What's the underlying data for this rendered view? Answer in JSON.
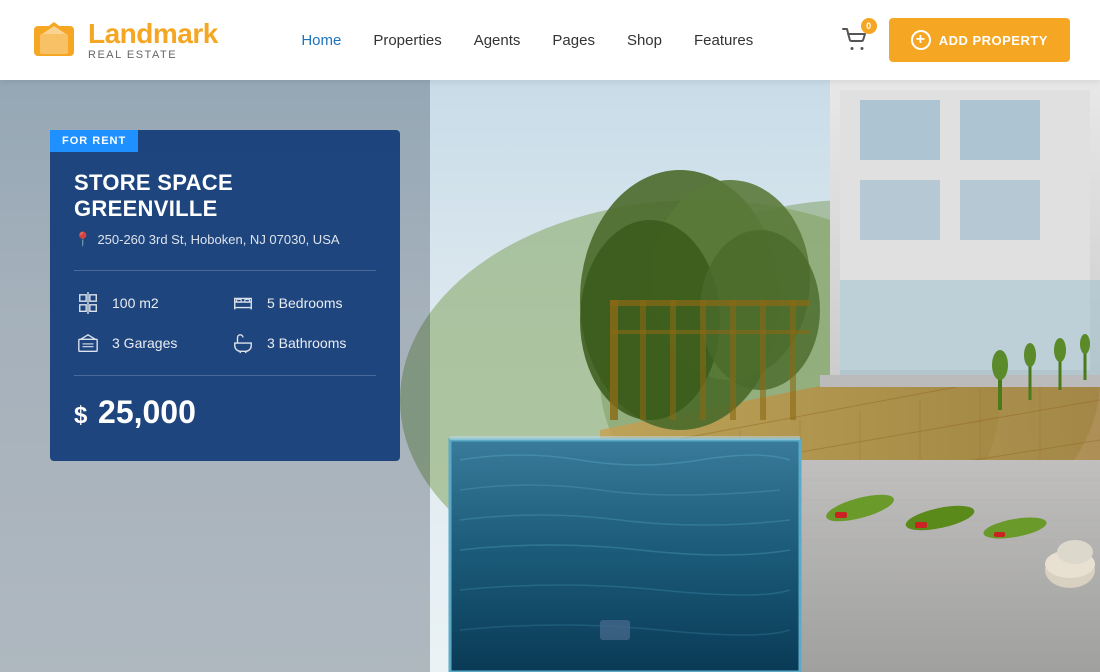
{
  "logo": {
    "name_part1": "Land",
    "name_part2": "mark",
    "subtitle": "Real Estate",
    "icon_alt": "landmark-logo"
  },
  "nav": {
    "items": [
      {
        "label": "Home",
        "active": true
      },
      {
        "label": "Properties",
        "active": false
      },
      {
        "label": "Agents",
        "active": false
      },
      {
        "label": "Pages",
        "active": false
      },
      {
        "label": "Shop",
        "active": false
      },
      {
        "label": "Features",
        "active": false
      }
    ]
  },
  "cart": {
    "badge": "0"
  },
  "add_property_btn": "ADD PROPERTY",
  "property": {
    "status": "FOR RENT",
    "title": "STORE SPACE GREENVILLE",
    "address": "250-260 3rd St, Hoboken, NJ 07030, USA",
    "specs": [
      {
        "icon": "area-icon",
        "label": "100 m2"
      },
      {
        "icon": "bed-icon",
        "label": "5 Bedrooms"
      },
      {
        "icon": "garage-icon",
        "label": "3 Garages"
      },
      {
        "icon": "bath-icon",
        "label": "3 Bathrooms"
      }
    ],
    "price_prefix": "$ ",
    "price": "25,000"
  }
}
